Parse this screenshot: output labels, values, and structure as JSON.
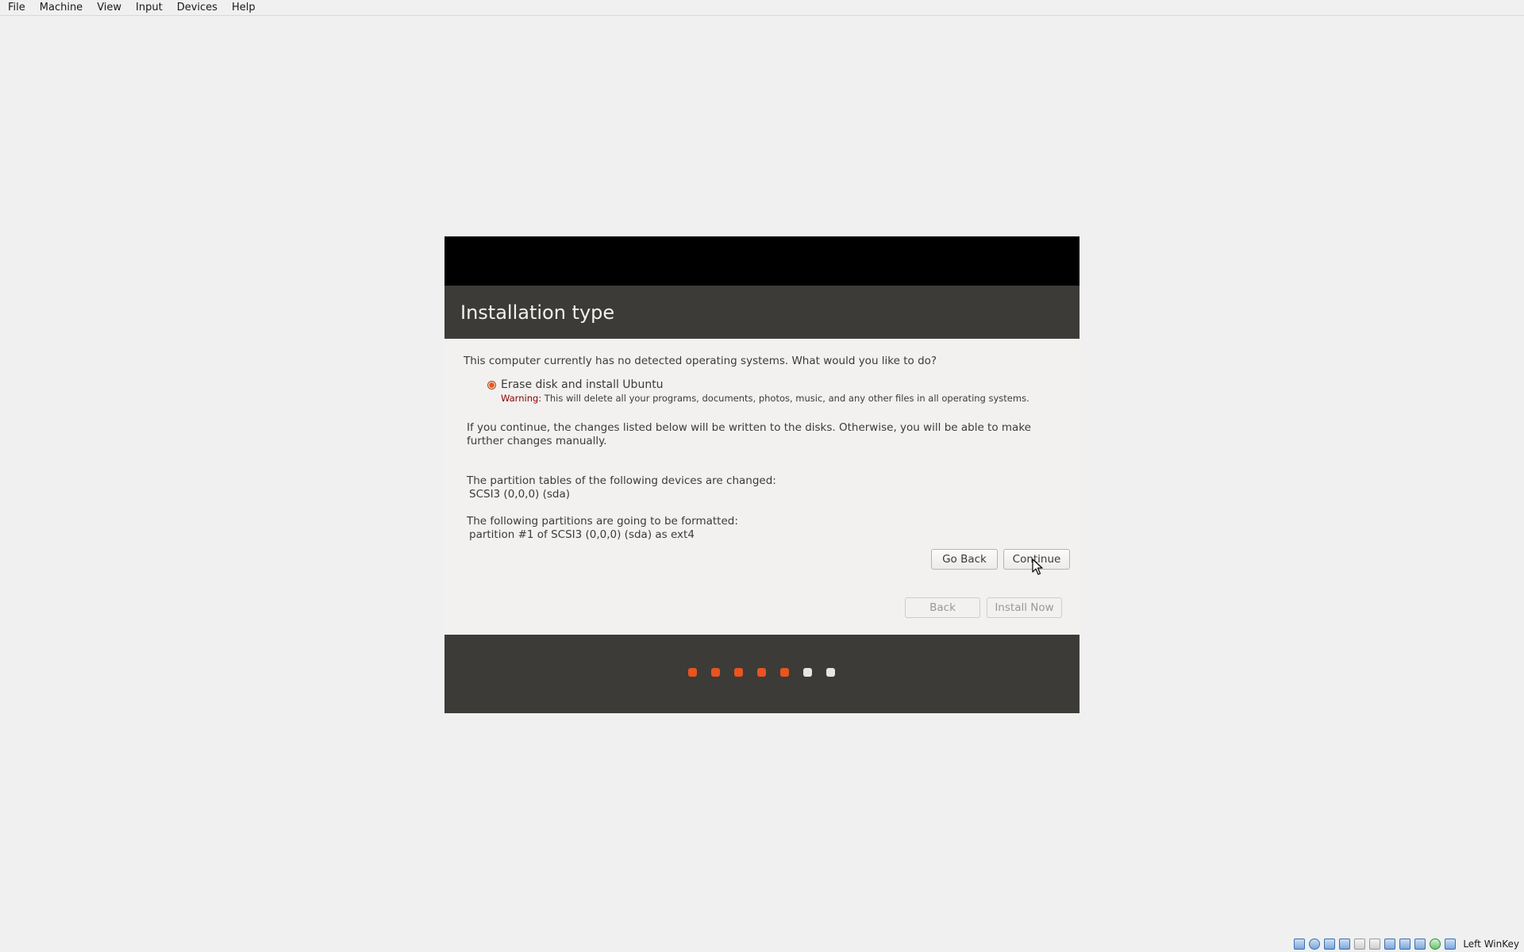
{
  "menubar": {
    "items": [
      "File",
      "Machine",
      "View",
      "Input",
      "Devices",
      "Help"
    ]
  },
  "installer": {
    "title": "Installation type",
    "question": "This computer currently has no detected operating systems. What would you like to do?",
    "option": {
      "label": "Erase disk and install Ubuntu",
      "selected": true,
      "warning_prefix": "Warning:",
      "warning_text": " This will delete all your programs, documents, photos, music, and any other files in all operating systems."
    },
    "paragraph1": "If you continue, the changes listed below will be written to the disks. Otherwise, you will be able to make further changes manually.",
    "paragraph2_heading": "The partition tables of the following devices are changed:",
    "paragraph2_item": "SCSI3 (0,0,0) (sda)",
    "paragraph3_heading": "The following partitions are going to be formatted:",
    "paragraph3_item": "partition #1 of SCSI3 (0,0,0) (sda) as ext4",
    "buttons": {
      "go_back": "Go Back",
      "continue": "Continue",
      "back": "Back",
      "install_now": "Install Now"
    },
    "progress": {
      "total_steps": 7,
      "completed_steps": 5,
      "active_color": "#e95420",
      "inactive_color": "#e5e5e5"
    }
  },
  "statusbar": {
    "host_key": "Left WinKey"
  },
  "colors": {
    "accent": "#e95420",
    "header_dark": "#3c3b37",
    "header_black": "#000000",
    "background": "#f2f1f0"
  }
}
